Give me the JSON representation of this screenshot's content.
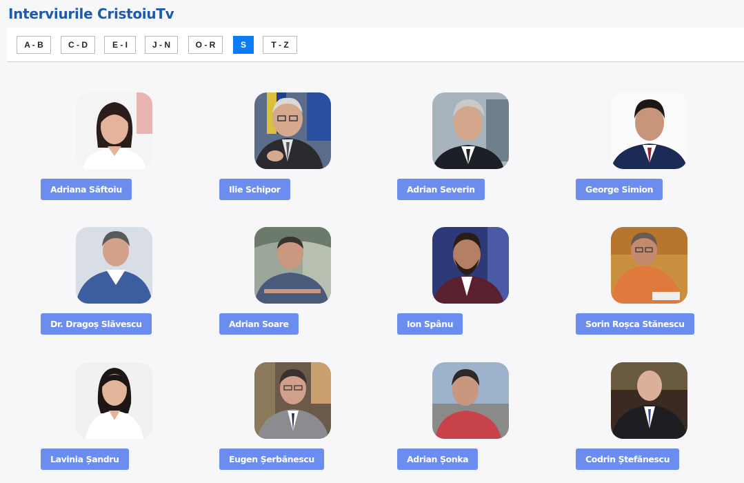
{
  "page": {
    "title": "Interviurile CristoiuTv"
  },
  "tabs": [
    {
      "label": "A - B",
      "active": false
    },
    {
      "label": "C - D",
      "active": false
    },
    {
      "label": "E - I",
      "active": false
    },
    {
      "label": "J - N",
      "active": false
    },
    {
      "label": "O - R",
      "active": false
    },
    {
      "label": "S",
      "active": true
    },
    {
      "label": "T - Z",
      "active": false
    }
  ],
  "colors": {
    "title": "#1f5aa6",
    "active_tab": "#0a7cf5",
    "name_button": "#6c8df0"
  },
  "interviews": [
    {
      "name": "Adriana Săftoiu",
      "photo_icon": "portrait-woman-dark-hair"
    },
    {
      "name": "Ilie Schipor",
      "photo_icon": "portrait-older-man-glasses"
    },
    {
      "name": "Adrian Severin",
      "photo_icon": "portrait-man-grey-hair"
    },
    {
      "name": "George Simion",
      "photo_icon": "portrait-man-dark-hair-suit"
    },
    {
      "name": "Dr. Dragoș Slăvescu",
      "photo_icon": "portrait-man-scrubs"
    },
    {
      "name": "Adrian Soare",
      "photo_icon": "portrait-man-checked-shirt"
    },
    {
      "name": "Ion Spânu",
      "photo_icon": "portrait-man-beard"
    },
    {
      "name": "Sorin Roșca Stănescu",
      "photo_icon": "portrait-man-orange-sweater"
    },
    {
      "name": "Lavinia Șandru",
      "photo_icon": "portrait-woman-white-shirt"
    },
    {
      "name": "Eugen Șerbănescu",
      "photo_icon": "portrait-man-grey-suit"
    },
    {
      "name": "Adrian Șonka",
      "photo_icon": "portrait-man-red-shirt"
    },
    {
      "name": "Codrin Ștefănescu",
      "photo_icon": "portrait-man-bald-suit"
    }
  ]
}
